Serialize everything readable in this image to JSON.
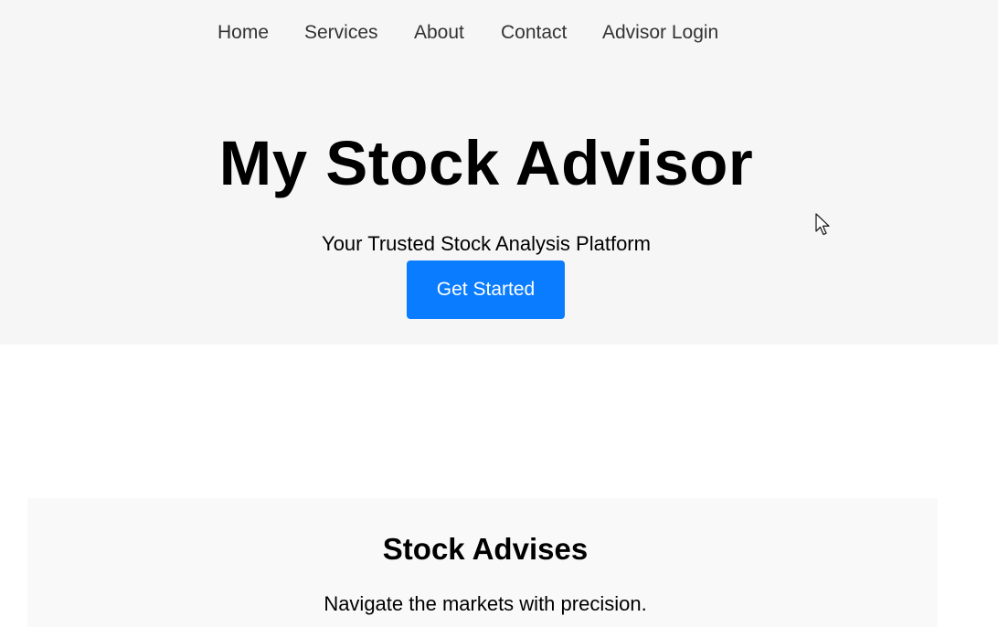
{
  "nav": {
    "items": [
      {
        "label": "Home"
      },
      {
        "label": "Services"
      },
      {
        "label": "About"
      },
      {
        "label": "Contact"
      },
      {
        "label": "Advisor Login"
      }
    ]
  },
  "hero": {
    "title": "My Stock Advisor",
    "subtitle": "Your Trusted Stock Analysis Platform",
    "cta_label": "Get Started"
  },
  "advises": {
    "title": "Stock Advises",
    "text": "Navigate the markets with precision."
  },
  "colors": {
    "hero_bg": "#f6f6f6",
    "button_bg": "#0a7cff",
    "button_text": "#ffffff",
    "nav_text": "#333333"
  },
  "icons": {
    "cursor": "mouse-pointer-icon"
  }
}
